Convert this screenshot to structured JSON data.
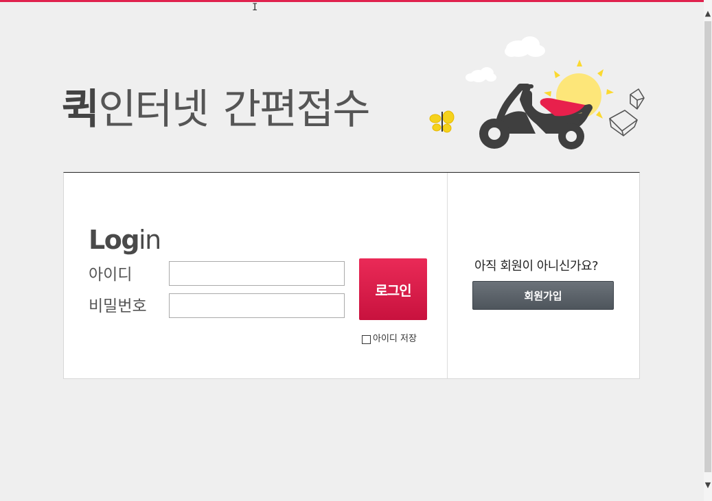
{
  "header": {
    "title_bold": "퀵",
    "title_regular": "인터넷",
    "title_suffix": "간편접수"
  },
  "login": {
    "heading_bold": "Log",
    "heading_regular": "in",
    "id_label": "아이디",
    "password_label": "비밀번호",
    "id_value": "",
    "password_value": "",
    "login_button": "로그인",
    "save_id_label": "아이디 저장",
    "save_id_checked": false
  },
  "join": {
    "question": "아직 회원이 아니신가요?",
    "button": "회원가입"
  },
  "colors": {
    "accent": "#e0224e",
    "join_button": "#5a6168",
    "background": "#efefef"
  },
  "icons": {
    "illustration": "scooter-delivery-illustration",
    "scroll_up": "chevron-up-icon",
    "scroll_down": "chevron-down-icon"
  }
}
